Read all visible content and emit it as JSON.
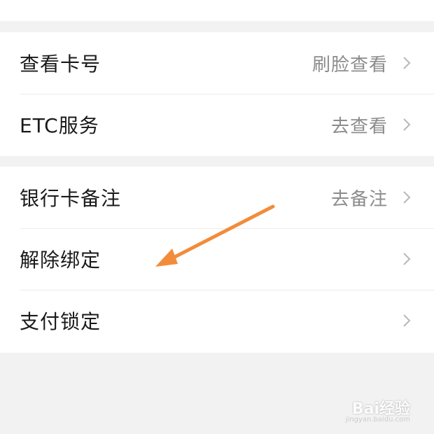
{
  "sections": [
    {
      "rows": [
        {
          "label": "查看卡号",
          "value": "刷脸查看"
        },
        {
          "label": "ETC服务",
          "value": "去查看"
        }
      ]
    },
    {
      "rows": [
        {
          "label": "银行卡备注",
          "value": "去备注"
        },
        {
          "label": "解除绑定",
          "value": ""
        },
        {
          "label": "支付锁定",
          "value": ""
        }
      ]
    }
  ],
  "annotation": {
    "color": "#f28c3a"
  },
  "watermark": {
    "brand": "Bai经验",
    "url": "jingyan.baidu.com"
  },
  "colors": {
    "background": "#f2f2f2",
    "row": "#ffffff",
    "chevron": "#b8b8b8"
  }
}
